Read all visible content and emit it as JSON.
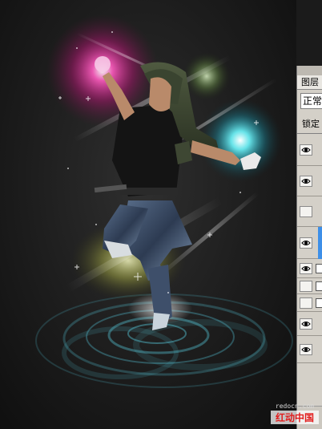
{
  "layers_panel": {
    "tab_label": "图层",
    "blend_mode": "正常",
    "lock_label": "锁定"
  },
  "layers": [
    {
      "visible": true,
      "selected": false
    },
    {
      "visible": true,
      "selected": false
    },
    {
      "visible": false,
      "selected": false
    },
    {
      "visible": true,
      "selected": true
    },
    {
      "visible": true,
      "selected": false
    },
    {
      "visible": false,
      "selected": false
    },
    {
      "visible": false,
      "selected": false
    },
    {
      "visible": true,
      "selected": false
    },
    {
      "visible": true,
      "selected": false
    }
  ],
  "watermark": {
    "url": "redocn.com",
    "name": "红动中国"
  },
  "colors": {
    "glow_magenta": "#ff2fa6",
    "glow_cyan": "#3ff6ff",
    "glow_yellow": "#e6ee7a",
    "glow_green": "#b8f08a",
    "ripple": "#5fc6d6",
    "selection_blue": "#3d8fe8"
  }
}
